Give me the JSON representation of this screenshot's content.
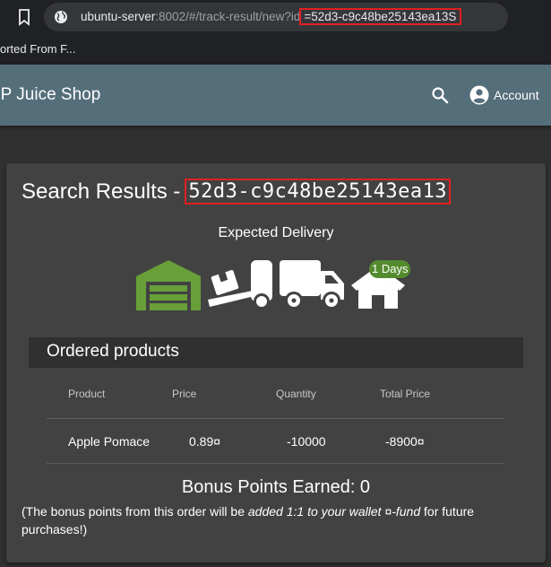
{
  "browser": {
    "url_host": "ubuntu-server",
    "url_path": ":8002/#/track-result/new?id",
    "url_id": "=52d3-c9c48be25143ea13S",
    "bookmark_folder": "orted From F..."
  },
  "toolbar": {
    "title": "SP Juice Shop",
    "account_label": "Account"
  },
  "results": {
    "heading": "Search Results -",
    "order_id": "52d3-c9c48be25143ea13",
    "expected_delivery": "Expected Delivery",
    "days_badge": "1 Days",
    "stages": [
      "warehouse-icon",
      "dolly-icon",
      "truck-icon",
      "home-icon"
    ],
    "stage_colors": {
      "active": "#689f38",
      "inactive": "#ffffff"
    }
  },
  "products": {
    "title": "Ordered products",
    "columns": [
      "Product",
      "Price",
      "Quantity",
      "Total Price"
    ],
    "rows": [
      {
        "product": "Apple Pomace",
        "price": "0.89¤",
        "quantity": "-10000",
        "total": "-8900¤"
      }
    ]
  },
  "bonus": {
    "title": "Bonus Points Earned: 0",
    "note_prefix": "(The bonus points from this order will be ",
    "note_emphasis": "added 1:1 to your wallet ¤-fund",
    "note_suffix": " for future purchases!)"
  }
}
